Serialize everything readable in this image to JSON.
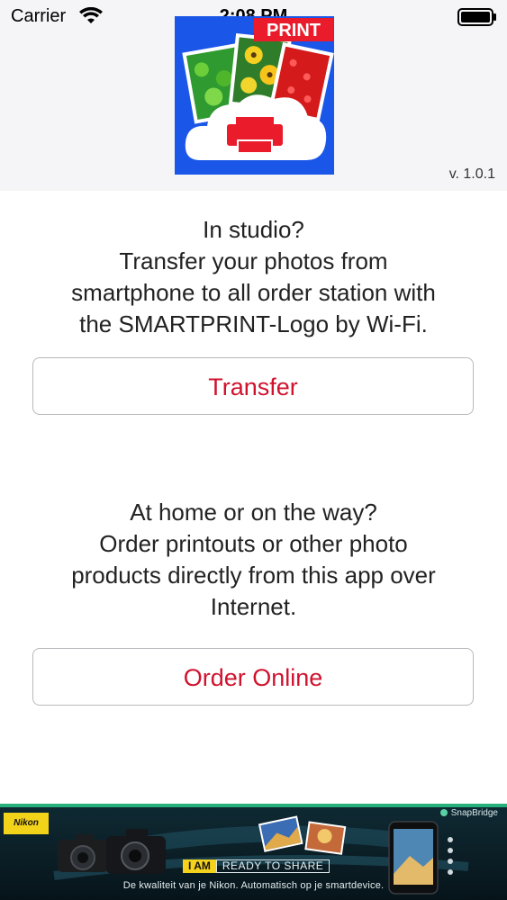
{
  "status_bar": {
    "carrier": "Carrier",
    "time": "2:08 PM"
  },
  "header": {
    "logo_badge": "PRINT",
    "version": "v. 1.0.1"
  },
  "studio": {
    "lines": [
      "In studio?",
      "Transfer your photos from",
      "smartphone to all order station with",
      "the SMARTPRINT-Logo by Wi-Fi."
    ],
    "button_label": "Transfer"
  },
  "home": {
    "lines": [
      "At home or on the way?",
      "Order printouts or other photo",
      "products directly from this app over",
      "Internet."
    ],
    "button_label": "Order Online"
  },
  "banner": {
    "brand": "Nikon",
    "partner": "SnapBridge",
    "tag_iam": "I AM",
    "tag_ready": "READY TO SHARE",
    "subtitle": "De kwaliteit van je Nikon. Automatisch op je smartdevice."
  },
  "colors": {
    "accent": "#d0122d",
    "logo_blue": "#1a56e8",
    "logo_red": "#ea1c2c"
  }
}
